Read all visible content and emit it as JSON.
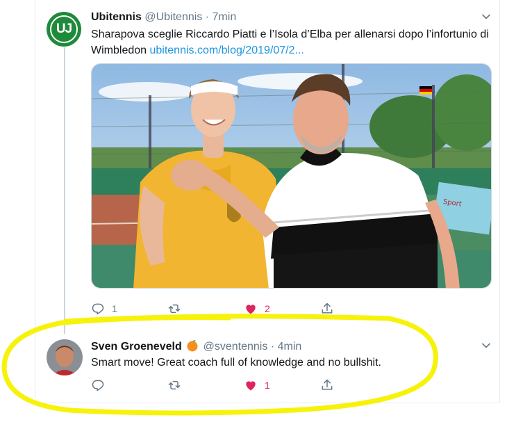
{
  "tweet": {
    "author_name": "Ubitennis",
    "handle": "@Ubitennis",
    "time": "7min",
    "avatar_text": "UJ",
    "text": "Sharapova sceglie Riccardo Piatti e l’Isola d’Elba per allenarsi dopo l’infortunio di Wimbledon",
    "link": "ubitennis.com/blog/2019/07/2...",
    "actions": {
      "reply_count": "1",
      "retweet_count": "",
      "like_count": "2"
    }
  },
  "reply": {
    "author_name": "Sven Groeneveld",
    "handle": "@sventennis",
    "time": "4min",
    "text": "Smart move! Great coach full of knowledge and no bullshit.",
    "actions": {
      "reply_count": "",
      "retweet_count": "",
      "like_count": "1"
    }
  },
  "colors": {
    "accent": "#1b95e0",
    "like": "#e0245e",
    "muted": "#657786",
    "ubitennis_green": "#1e8a3a",
    "highlight": "#f7f20a"
  },
  "icons": [
    "reply-icon",
    "retweet-icon",
    "heart-icon",
    "share-icon",
    "chevron-down-icon",
    "orange-emoji-icon"
  ]
}
